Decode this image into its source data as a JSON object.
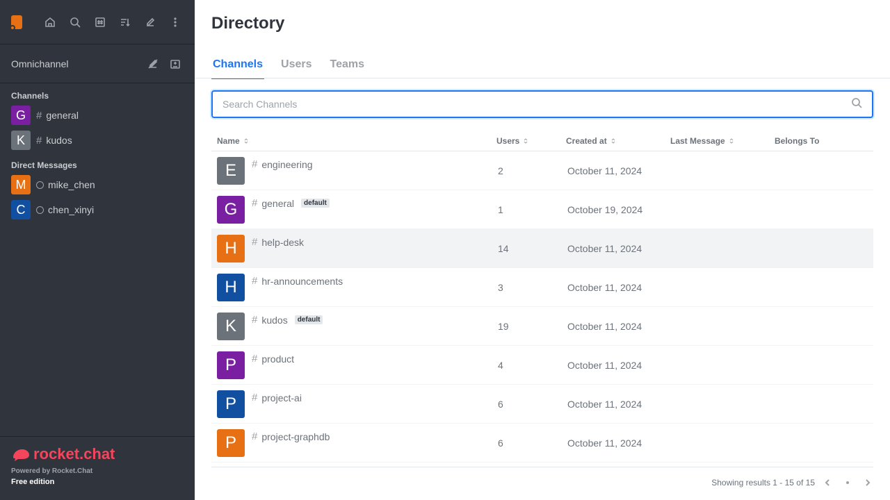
{
  "sidebar": {
    "omnichannel_label": "Omnichannel",
    "channels_heading": "Channels",
    "channels": [
      {
        "initial": "G",
        "name": "general",
        "color": "#7a1fa2"
      },
      {
        "initial": "K",
        "name": "kudos",
        "color": "#6c727a"
      }
    ],
    "dm_heading": "Direct Messages",
    "dms": [
      {
        "initial": "M",
        "name": "mike_chen",
        "color": "#e67013"
      },
      {
        "initial": "C",
        "name": "chen_xinyi",
        "color": "#1150a0"
      }
    ],
    "logo_text": "rocket.chat",
    "powered_by": "Powered by Rocket.Chat",
    "edition": "Free edition"
  },
  "main": {
    "title": "Directory",
    "tabs": [
      {
        "label": "Channels",
        "active": true
      },
      {
        "label": "Users",
        "active": false
      },
      {
        "label": "Teams",
        "active": false
      }
    ],
    "search_placeholder": "Search Channels",
    "columns": {
      "name": "Name",
      "users": "Users",
      "created": "Created at",
      "last_message": "Last Message",
      "belongs_to": "Belongs To"
    },
    "rows": [
      {
        "initial": "E",
        "name": "engineering",
        "badge": "",
        "users": "2",
        "created": "October 11, 2024",
        "color": "#6c727a"
      },
      {
        "initial": "G",
        "name": "general",
        "badge": "default",
        "users": "1",
        "created": "October 19, 2024",
        "color": "#7a1fa2"
      },
      {
        "initial": "H",
        "name": "help-desk",
        "badge": "",
        "users": "14",
        "created": "October 11, 2024",
        "color": "#e67013"
      },
      {
        "initial": "H",
        "name": "hr-announcements",
        "badge": "",
        "users": "3",
        "created": "October 11, 2024",
        "color": "#1150a0"
      },
      {
        "initial": "K",
        "name": "kudos",
        "badge": "default",
        "users": "19",
        "created": "October 11, 2024",
        "color": "#6c727a"
      },
      {
        "initial": "P",
        "name": "product",
        "badge": "",
        "users": "4",
        "created": "October 11, 2024",
        "color": "#7a1fa2"
      },
      {
        "initial": "P",
        "name": "project-ai",
        "badge": "",
        "users": "6",
        "created": "October 11, 2024",
        "color": "#1150a0"
      },
      {
        "initial": "P",
        "name": "project-graphdb",
        "badge": "",
        "users": "6",
        "created": "October 11, 2024",
        "color": "#e67013"
      }
    ],
    "results_text": "Showing results 1 - 15 of 15"
  }
}
